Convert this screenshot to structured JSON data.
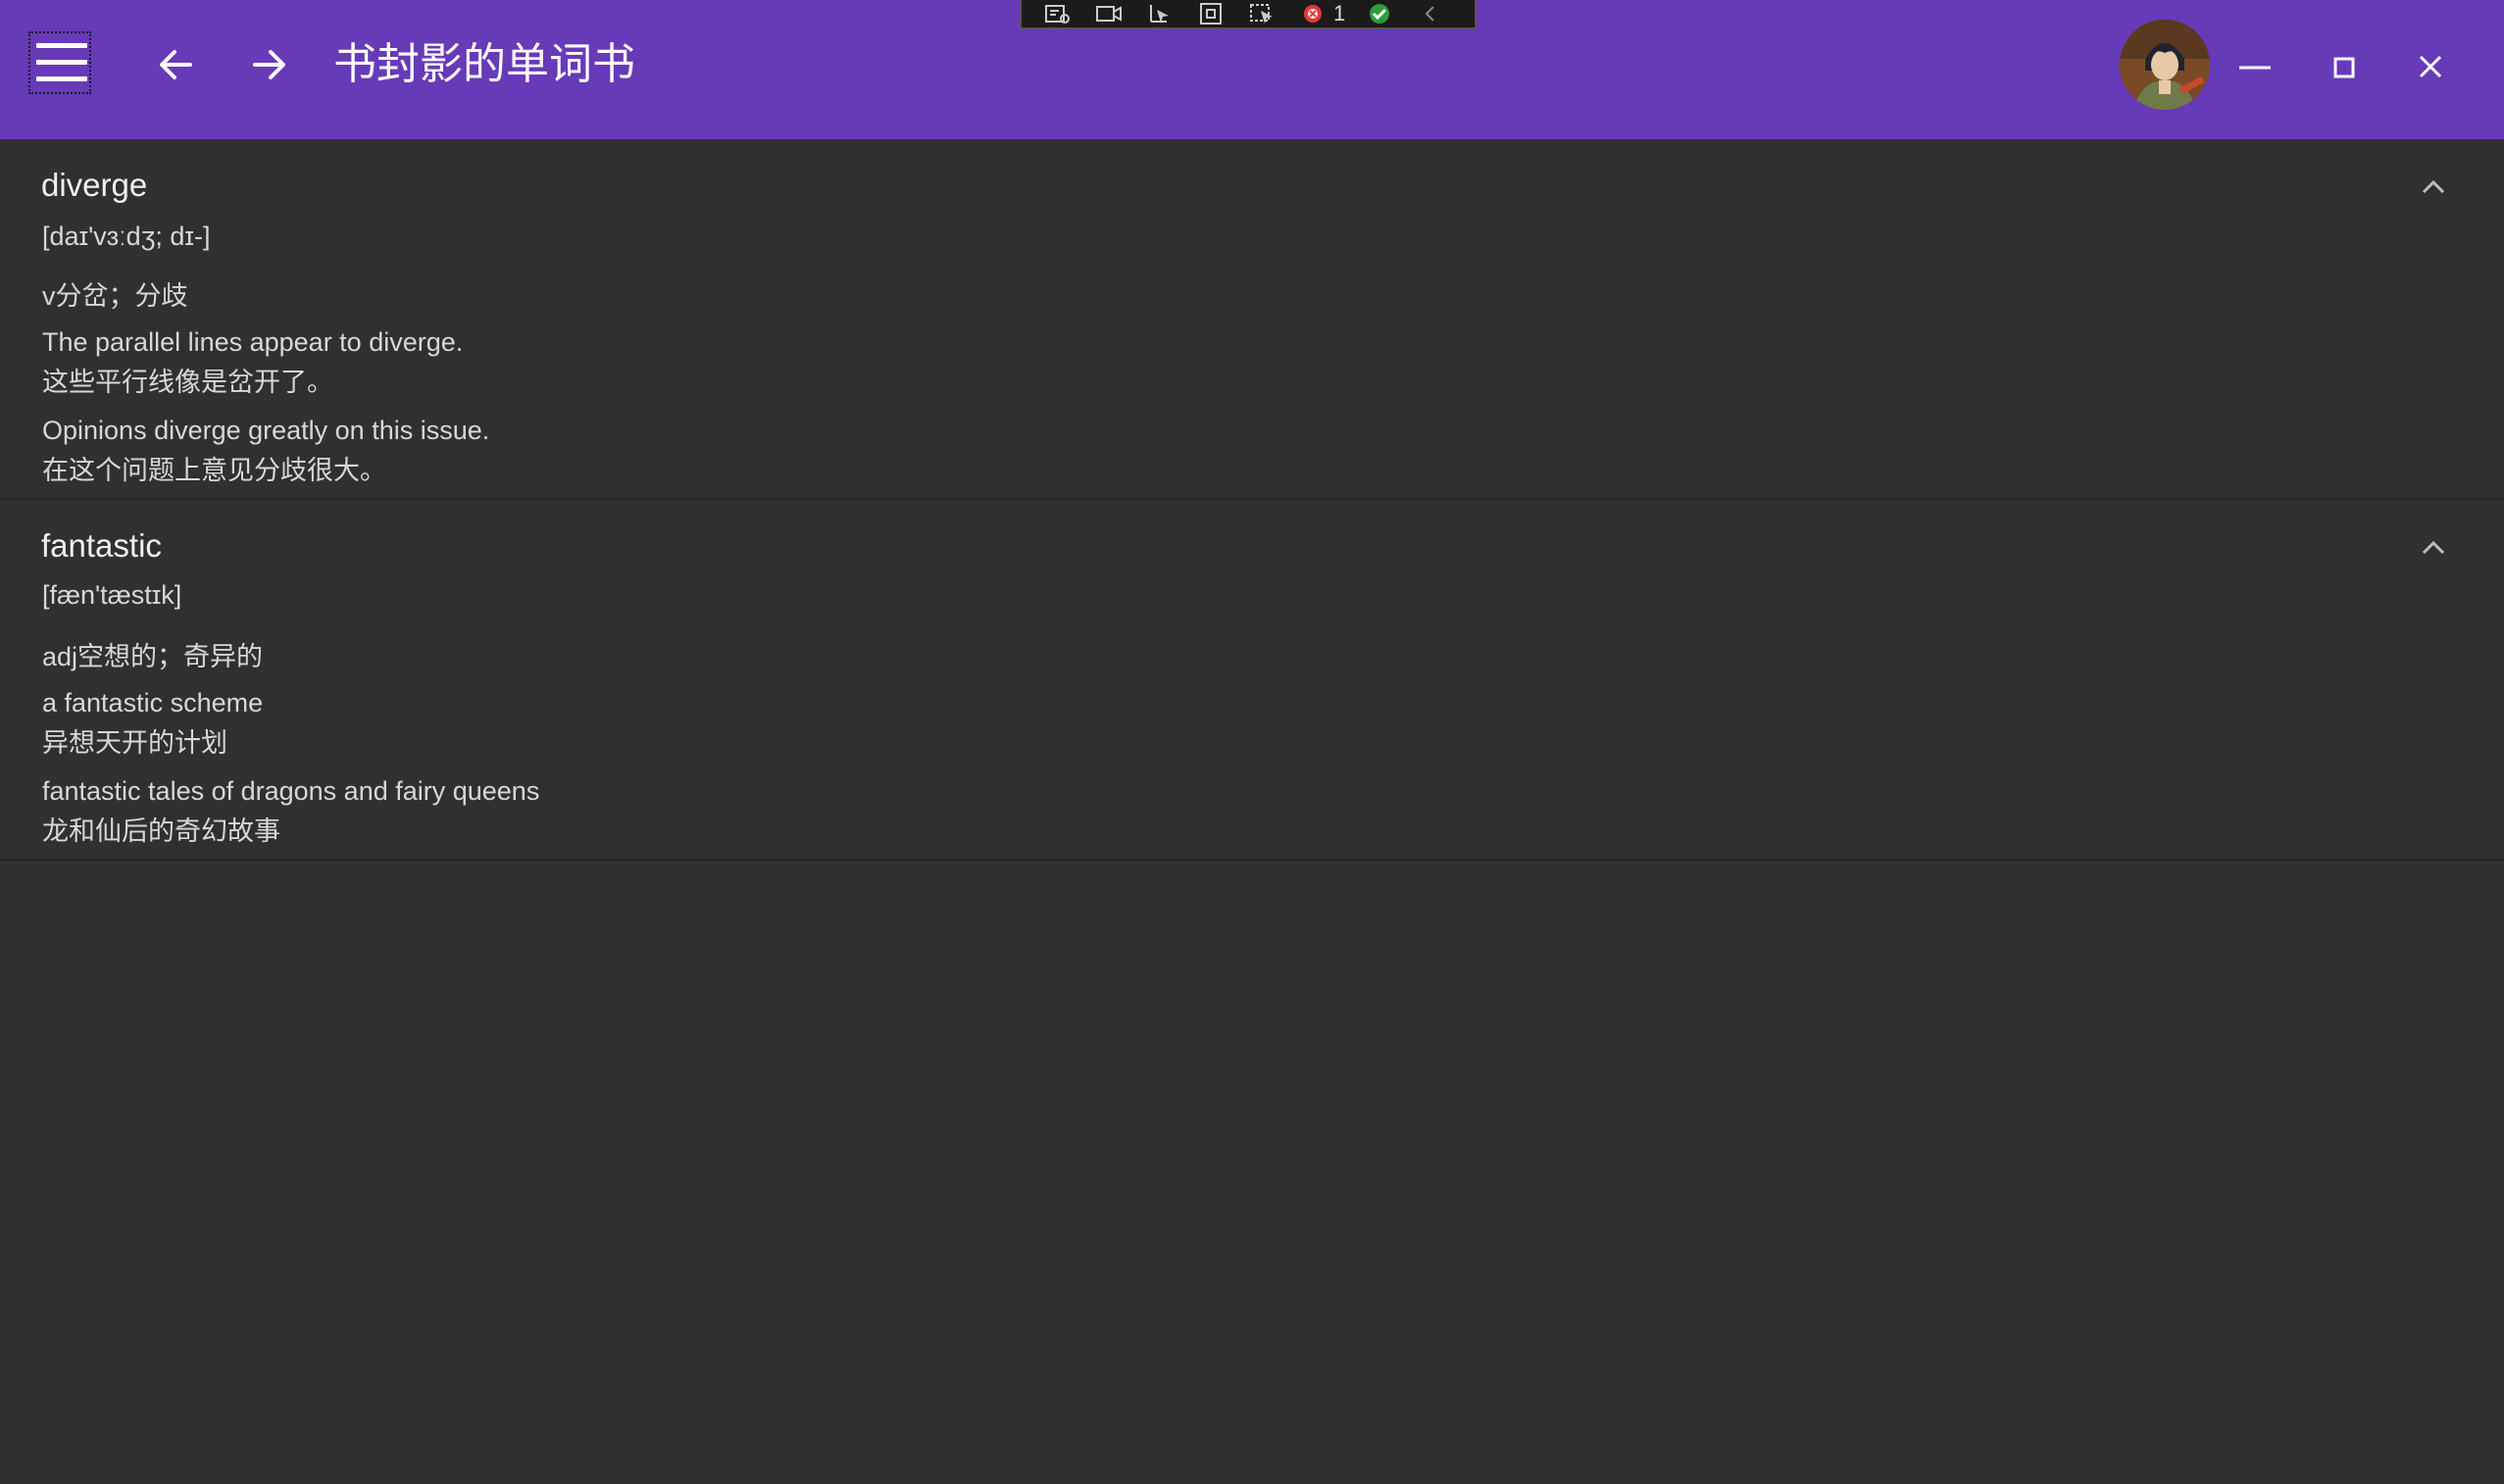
{
  "app": {
    "title": "书封影的单词书",
    "accent": "#673ab7",
    "background": "#303030"
  },
  "header": {
    "menu_icon": "hamburger-menu-icon",
    "back_icon": "arrow-left-icon",
    "forward_icon": "arrow-right-icon",
    "avatar_icon": "user-avatar",
    "minimize_icon": "minimize-icon",
    "maximize_icon": "maximize-icon",
    "close_icon": "close-icon"
  },
  "debug_toolbar": {
    "icons": [
      "live-visual-tree-icon",
      "record-icon",
      "select-element-icon",
      "display-layout-adorners-icon",
      "track-focus-icon",
      "binding-failures-icon",
      "hot-reload-check-icon",
      "collapse-chevron-icon"
    ],
    "failure_count": "1"
  },
  "words": [
    {
      "word": "diverge",
      "phonetic": "[daɪ'vɜːdʒ; dɪ-]",
      "meaning": "v分岔；分歧",
      "examples": [
        {
          "en": "The parallel lines appear to diverge.",
          "zh": "这些平行线像是岔开了。"
        },
        {
          "en": "Opinions diverge greatly on this issue.",
          "zh": "在这个问题上意见分歧很大。"
        }
      ]
    },
    {
      "word": "fantastic",
      "phonetic": "[fæn'tæstɪk]",
      "meaning": "adj空想的；奇异的",
      "examples": [
        {
          "en": "a fantastic scheme",
          "zh": "异想天开的计划"
        },
        {
          "en": "fantastic tales of dragons and fairy queens",
          "zh": "龙和仙后的奇幻故事"
        }
      ]
    }
  ]
}
